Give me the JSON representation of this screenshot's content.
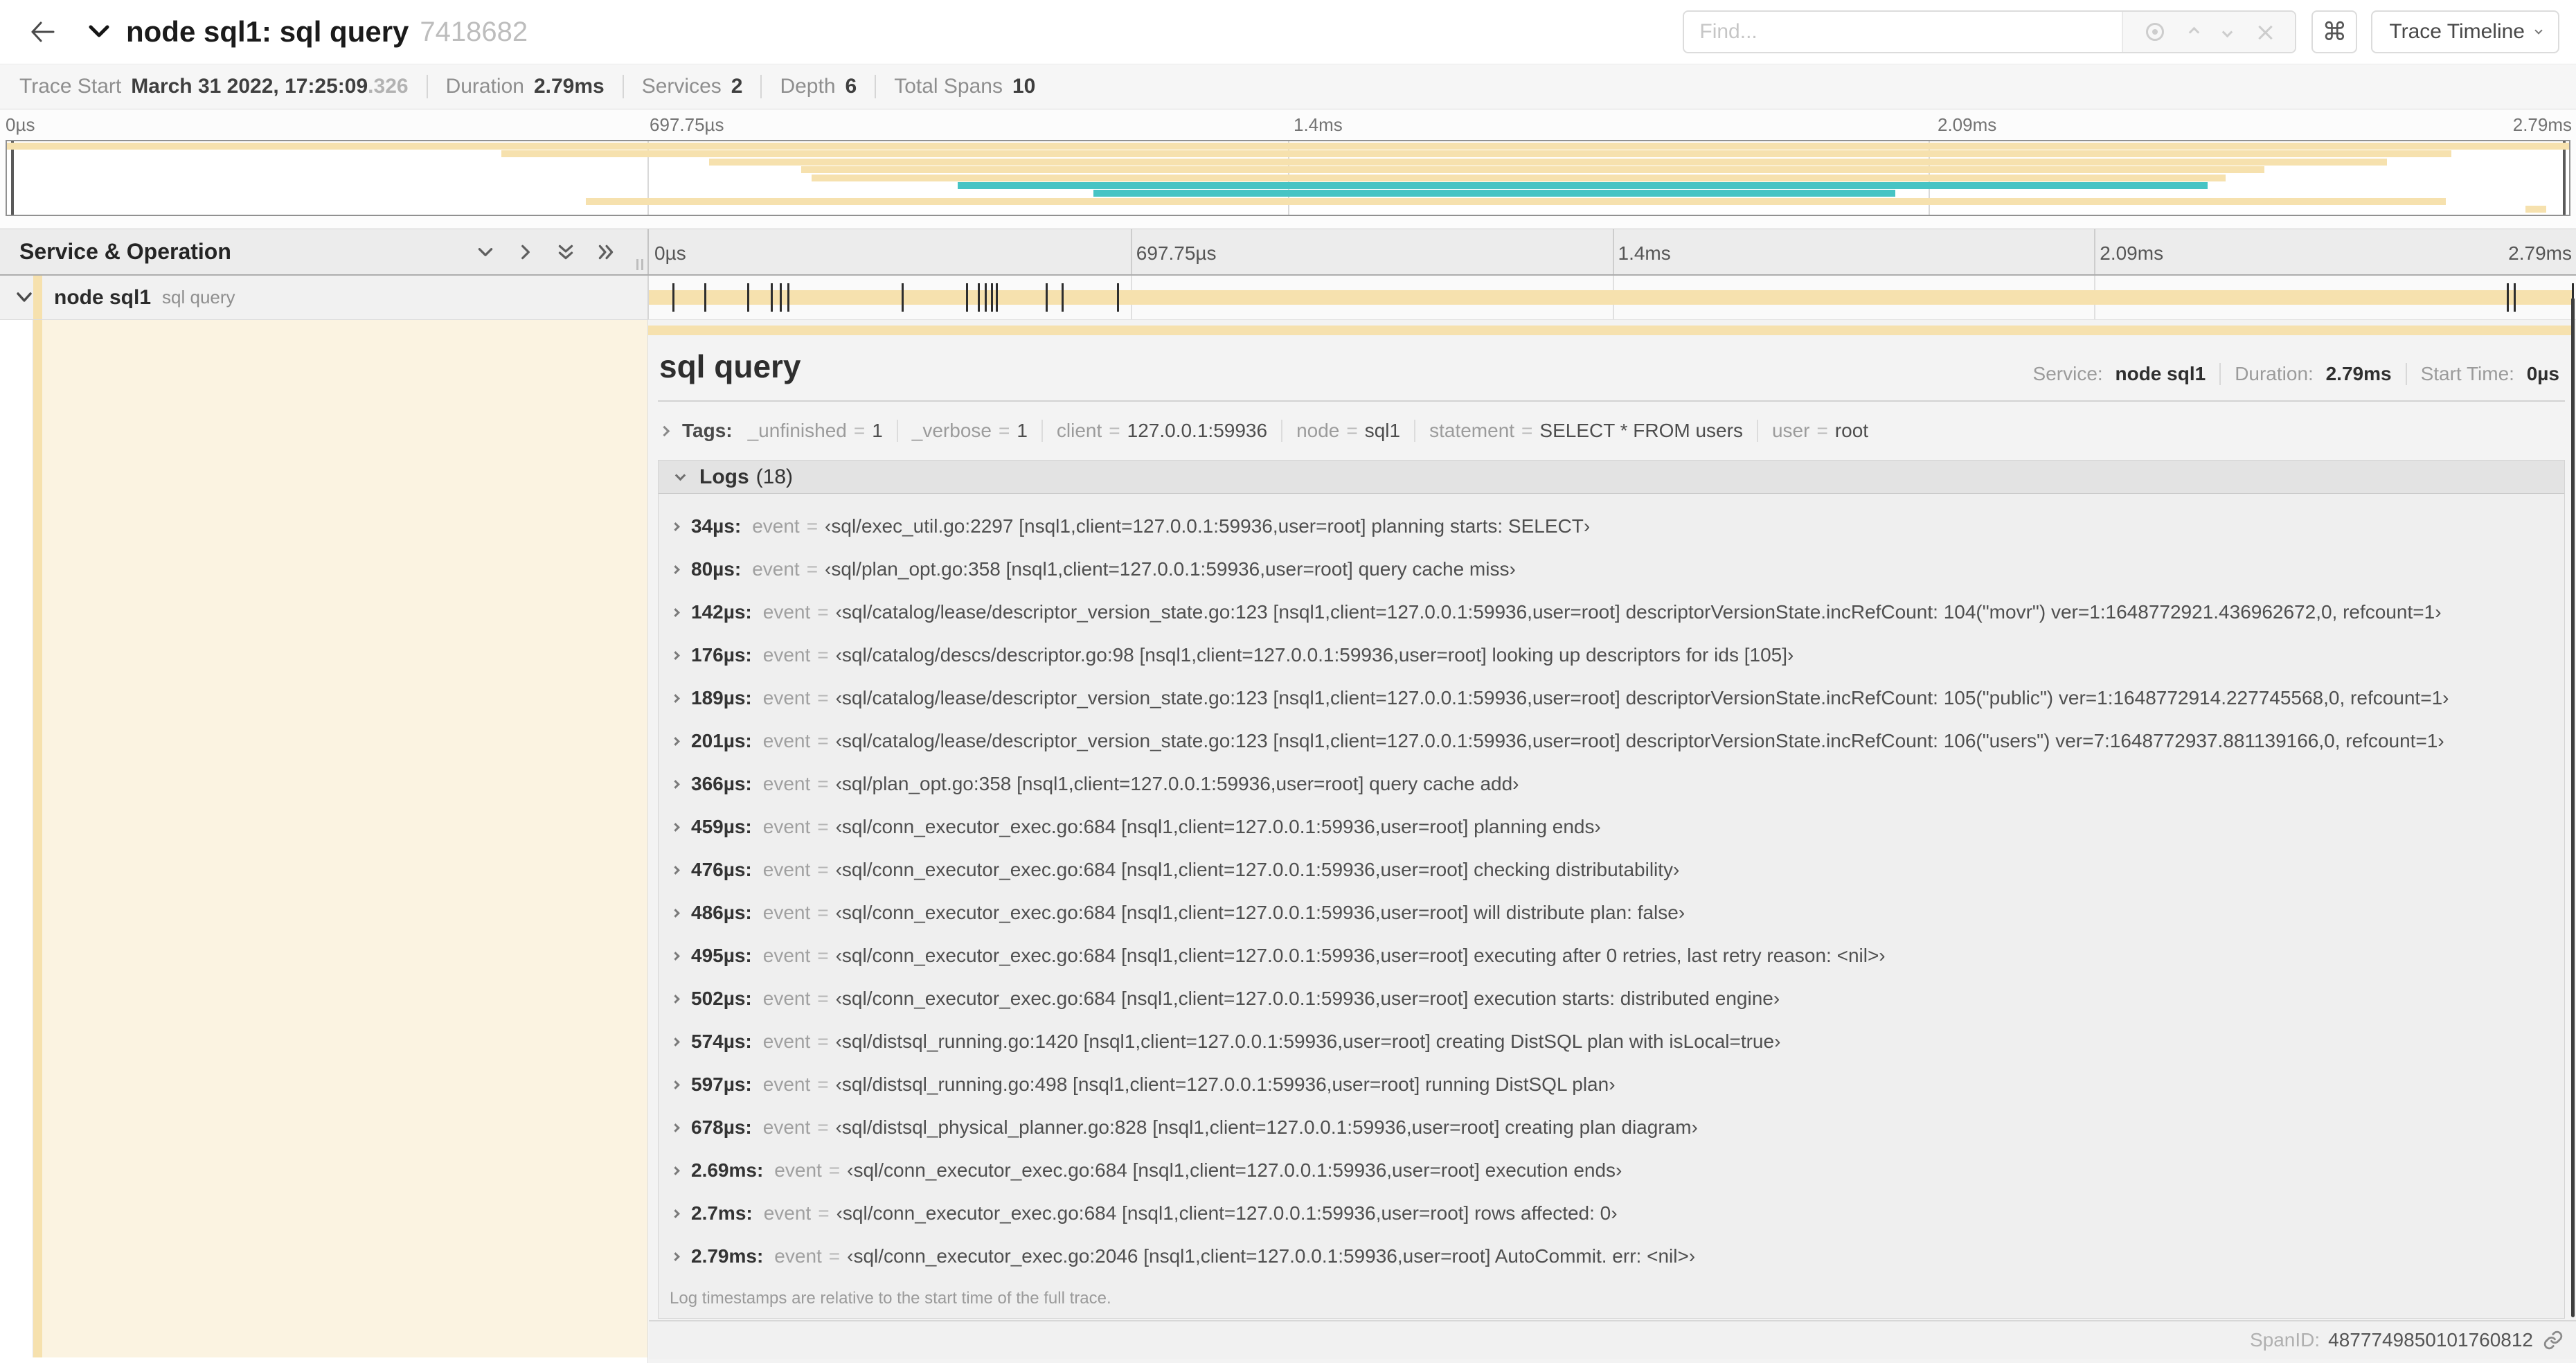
{
  "colors": {
    "tan": "#F6E1AE",
    "teal": "#47C4C4",
    "cream": "#FBF3E1"
  },
  "header": {
    "title": "node sql1: sql query",
    "trace_id": "7418682",
    "find_placeholder": "Find...",
    "shortcut_key": "⌘",
    "view_selector": "Trace Timeline"
  },
  "stats": {
    "items": [
      {
        "label": "Trace Start",
        "value": "March 31 2022, 17:25:09",
        "suffix": ".326"
      },
      {
        "label": "Duration",
        "value": "2.79ms"
      },
      {
        "label": "Services",
        "value": "2"
      },
      {
        "label": "Depth",
        "value": "6"
      },
      {
        "label": "Total Spans",
        "value": "10"
      }
    ]
  },
  "timeline": {
    "ticks": [
      "0µs",
      "697.75µs",
      "1.4ms",
      "2.09ms",
      "2.79ms"
    ],
    "duration_us": 2790
  },
  "minimap": {
    "spans": [
      {
        "row": 0,
        "left": 0,
        "width": 100,
        "color": "tan"
      },
      {
        "row": 1,
        "left": 19.3,
        "width": 76.1,
        "color": "tan"
      },
      {
        "row": 2,
        "left": 27.4,
        "width": 65.5,
        "color": "tan"
      },
      {
        "row": 3,
        "left": 31.0,
        "width": 57.1,
        "color": "tan"
      },
      {
        "row": 4,
        "left": 31.4,
        "width": 55.2,
        "color": "tan"
      },
      {
        "row": 5,
        "left": 37.1,
        "width": 48.8,
        "color": "teal"
      },
      {
        "row": 6,
        "left": 42.4,
        "width": 31.3,
        "color": "teal"
      },
      {
        "row": 7,
        "left": 22.6,
        "width": 72.6,
        "color": "tan"
      },
      {
        "row": 8,
        "left": 98.3,
        "width": 0.8,
        "color": "tan"
      }
    ]
  },
  "span_list": {
    "header": "Service & Operation",
    "row": {
      "service": "node sql1",
      "operation": "sql query"
    }
  },
  "detail": {
    "title": "sql query",
    "meta": [
      {
        "label": "Service:",
        "value": "node sql1"
      },
      {
        "label": "Duration:",
        "value": "2.79ms"
      },
      {
        "label": "Start Time:",
        "value": "0µs"
      }
    ],
    "tags_label": "Tags:",
    "tags": [
      {
        "key": "_unfinished",
        "value": "1"
      },
      {
        "key": "_verbose",
        "value": "1"
      },
      {
        "key": "client",
        "value": "127.0.0.1:59936"
      },
      {
        "key": "node",
        "value": "sql1"
      },
      {
        "key": "statement",
        "value": "SELECT * FROM users"
      },
      {
        "key": "user",
        "value": "root"
      }
    ],
    "logs_title": "Logs",
    "logs_count": "(18)",
    "logs": [
      {
        "t": "34µs:",
        "t_us": 34,
        "key": "event",
        "value": "‹sql/exec_util.go:2297 [nsql1,client=127.0.0.1:59936,user=root] planning starts: SELECT›"
      },
      {
        "t": "80µs:",
        "t_us": 80,
        "key": "event",
        "value": "‹sql/plan_opt.go:358 [nsql1,client=127.0.0.1:59936,user=root] query cache miss›"
      },
      {
        "t": "142µs:",
        "t_us": 142,
        "key": "event",
        "value": "‹sql/catalog/lease/descriptor_version_state.go:123 [nsql1,client=127.0.0.1:59936,user=root] descriptorVersionState.incRefCount: 104(\"movr\") ver=1:1648772921.436962672,0, refcount=1›"
      },
      {
        "t": "176µs:",
        "t_us": 176,
        "key": "event",
        "value": "‹sql/catalog/descs/descriptor.go:98 [nsql1,client=127.0.0.1:59936,user=root] looking up descriptors for ids [105]›"
      },
      {
        "t": "189µs:",
        "t_us": 189,
        "key": "event",
        "value": "‹sql/catalog/lease/descriptor_version_state.go:123 [nsql1,client=127.0.0.1:59936,user=root] descriptorVersionState.incRefCount: 105(\"public\") ver=1:1648772914.227745568,0, refcount=1›"
      },
      {
        "t": "201µs:",
        "t_us": 201,
        "key": "event",
        "value": "‹sql/catalog/lease/descriptor_version_state.go:123 [nsql1,client=127.0.0.1:59936,user=root] descriptorVersionState.incRefCount: 106(\"users\") ver=7:1648772937.881139166,0, refcount=1›"
      },
      {
        "t": "366µs:",
        "t_us": 366,
        "key": "event",
        "value": "‹sql/plan_opt.go:358 [nsql1,client=127.0.0.1:59936,user=root] query cache add›"
      },
      {
        "t": "459µs:",
        "t_us": 459,
        "key": "event",
        "value": "‹sql/conn_executor_exec.go:684 [nsql1,client=127.0.0.1:59936,user=root] planning ends›"
      },
      {
        "t": "476µs:",
        "t_us": 476,
        "key": "event",
        "value": "‹sql/conn_executor_exec.go:684 [nsql1,client=127.0.0.1:59936,user=root] checking distributability›"
      },
      {
        "t": "486µs:",
        "t_us": 486,
        "key": "event",
        "value": "‹sql/conn_executor_exec.go:684 [nsql1,client=127.0.0.1:59936,user=root] will distribute plan: false›"
      },
      {
        "t": "495µs:",
        "t_us": 495,
        "key": "event",
        "value": "‹sql/conn_executor_exec.go:684 [nsql1,client=127.0.0.1:59936,user=root] executing after 0 retries, last retry reason: <nil>›"
      },
      {
        "t": "502µs:",
        "t_us": 502,
        "key": "event",
        "value": "‹sql/conn_executor_exec.go:684 [nsql1,client=127.0.0.1:59936,user=root] execution starts: distributed engine›"
      },
      {
        "t": "574µs:",
        "t_us": 574,
        "key": "event",
        "value": "‹sql/distsql_running.go:1420 [nsql1,client=127.0.0.1:59936,user=root] creating DistSQL plan with isLocal=true›"
      },
      {
        "t": "597µs:",
        "t_us": 597,
        "key": "event",
        "value": "‹sql/distsql_running.go:498 [nsql1,client=127.0.0.1:59936,user=root] running DistSQL plan›"
      },
      {
        "t": "678µs:",
        "t_us": 678,
        "key": "event",
        "value": "‹sql/distsql_physical_planner.go:828 [nsql1,client=127.0.0.1:59936,user=root] creating plan diagram›"
      },
      {
        "t": "2.69ms:",
        "t_us": 2690,
        "key": "event",
        "value": "‹sql/conn_executor_exec.go:684 [nsql1,client=127.0.0.1:59936,user=root] execution ends›"
      },
      {
        "t": "2.7ms:",
        "t_us": 2700,
        "key": "event",
        "value": "‹sql/conn_executor_exec.go:684 [nsql1,client=127.0.0.1:59936,user=root] rows affected: 0›"
      },
      {
        "t": "2.79ms:",
        "t_us": 2790,
        "key": "event",
        "value": "‹sql/conn_executor_exec.go:2046 [nsql1,client=127.0.0.1:59936,user=root] AutoCommit. err: <nil>›"
      }
    ],
    "logs_note": "Log timestamps are relative to the start time of the full trace.",
    "footer_label": "SpanID:",
    "footer_value": "4877749850101760812"
  }
}
